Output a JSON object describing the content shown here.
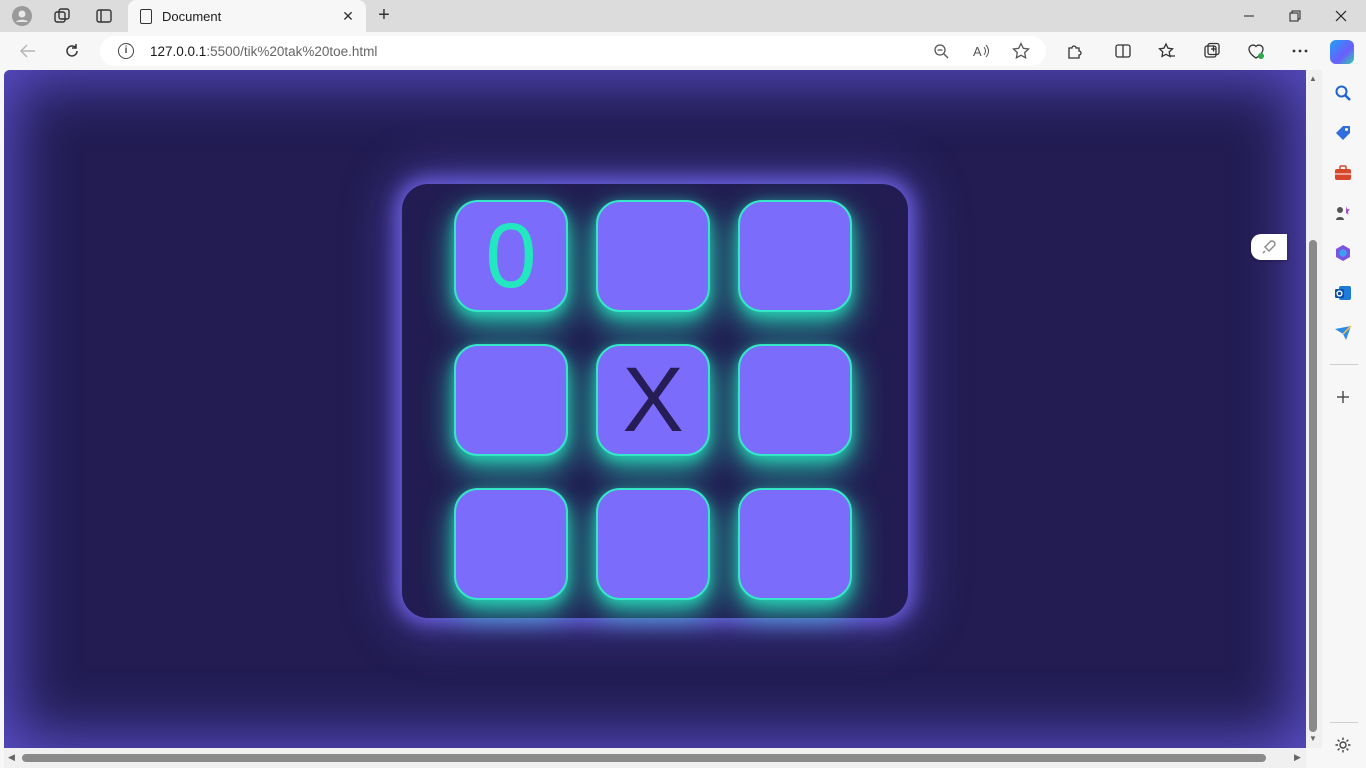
{
  "browser": {
    "tab_title": "Document",
    "url_host": "127.0.0.1",
    "url_rest": ":5500/tik%20tak%20toe.html",
    "new_tab_label": "+",
    "close_glyph": "✕"
  },
  "game": {
    "cells": [
      "0",
      "",
      "",
      "",
      "X",
      "",
      "",
      "",
      ""
    ],
    "colors": {
      "background": "#221c52",
      "cell": "#7b6cfb",
      "glow": "#35e6c8",
      "o_mark": "#22e7bf",
      "x_mark": "#261d57"
    }
  },
  "icons": {
    "sidebar": [
      "search-icon",
      "shopping-tag-icon",
      "toolbox-icon",
      "games-icon",
      "office-icon",
      "outlook-icon",
      "send-icon",
      "add-icon",
      "settings-icon"
    ]
  }
}
